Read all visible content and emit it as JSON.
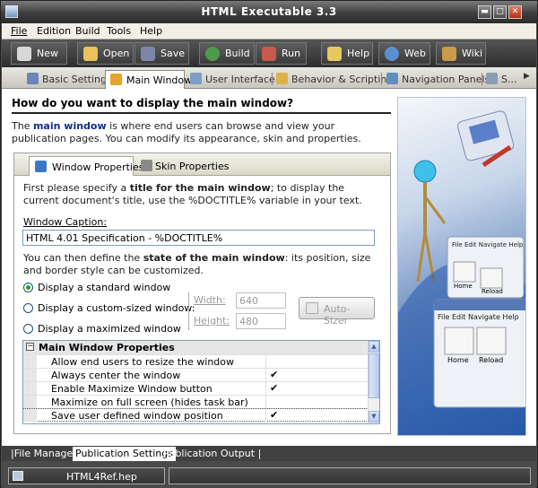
{
  "window": {
    "title": "HTML Executable 3.3",
    "min_glyph": "▬",
    "max_glyph": "□",
    "close_glyph": "✕"
  },
  "menu": [
    "File",
    "Edition",
    "Build",
    "Tools",
    "Help"
  ],
  "toolbar": [
    {
      "label": "New",
      "icon": "new-project-icon",
      "color": "#d8d8d8"
    },
    {
      "label": "Open",
      "icon": "open-folder-icon",
      "color": "#e8c35a"
    },
    {
      "label": "Save",
      "icon": "save-icon",
      "color": "#7d86a8"
    },
    {
      "label": "Build",
      "icon": "build-globe-icon",
      "color": "#4f9a4a"
    },
    {
      "label": "Run",
      "icon": "run-icon",
      "color": "#c75a4a"
    },
    {
      "label": "Help",
      "icon": "help-icon",
      "color": "#e6c860"
    },
    {
      "label": "Web",
      "icon": "web-globe-icon",
      "color": "#5a8fd0"
    },
    {
      "label": "Wiki",
      "icon": "wiki-icon",
      "color": "#c99b4a"
    }
  ],
  "tabs": [
    {
      "label": "Basic Settings",
      "icon": "basic-settings-icon",
      "active": false
    },
    {
      "label": "Main Window",
      "icon": "main-window-icon",
      "active": true
    },
    {
      "label": "User Interface",
      "icon": "user-interface-icon",
      "active": false
    },
    {
      "label": "Behavior & Scripting",
      "icon": "behavior-scripting-icon",
      "active": false
    },
    {
      "label": "Navigation Panels",
      "icon": "navigation-panels-icon",
      "active": false
    },
    {
      "label": "S...",
      "icon": "more-tab-icon",
      "active": false
    }
  ],
  "tab_scroll_glyph": "▶",
  "main": {
    "heading": "How do you want to display the main window?",
    "intro_before": "The ",
    "intro_bold": "main window",
    "intro_after": " is where end users can browse and view your publication pages. You can modify its appearance, skin and properties.",
    "panel_tabs": [
      {
        "label": "Window Properties",
        "active": true
      },
      {
        "label": "Skin Properties",
        "active": false
      }
    ],
    "para1_before": "First please specify a ",
    "para1_bold": "title for the main window",
    "para1_after": "; to display the current document's title, use the %DOCTITLE% variable in your text.",
    "caption_label": "Window Caption:",
    "caption_value": "HTML 4.01 Specification - %DOCTITLE%",
    "para2_before": "You can then define the ",
    "para2_bold": "state of the main window",
    "para2_after": ": its position, size and border style can be customized.",
    "radios": [
      {
        "label": "Display a standard window",
        "checked": true
      },
      {
        "label": "Display a custom-sized window:",
        "checked": false
      },
      {
        "label": "Display a maximized window",
        "checked": false
      }
    ],
    "width_label": "Width:",
    "width_value": "640",
    "height_label": "Height:",
    "height_value": "480",
    "autosizer_label": "Auto-Sizer",
    "props_header": "Main Window Properties",
    "props_toggle": "−",
    "props": [
      {
        "name": "Allow end users to resize the window",
        "checked": false
      },
      {
        "name": "Always center the window",
        "checked": true
      },
      {
        "name": "Enable Maximize Window button",
        "checked": true
      },
      {
        "name": "Maximize on full screen (hides task bar)",
        "checked": false
      },
      {
        "name": "Save user defined window position",
        "checked": true
      }
    ],
    "check_glyph": "✔",
    "scroll_up": "▲",
    "scroll_down": "▼"
  },
  "art": {
    "menu1": [
      "File",
      "Edit",
      "Navigate",
      "Help"
    ],
    "buttons1": [
      "Home",
      "Reload"
    ],
    "menu2": [
      "File",
      "Edit",
      "Navigate",
      "Help"
    ],
    "buttons2": [
      "Home",
      "Reload"
    ]
  },
  "bottom_tabs": [
    "|File Manager",
    "Publication Settings",
    "Publication Output |"
  ],
  "status": {
    "file": "HTML4Ref.hep"
  }
}
